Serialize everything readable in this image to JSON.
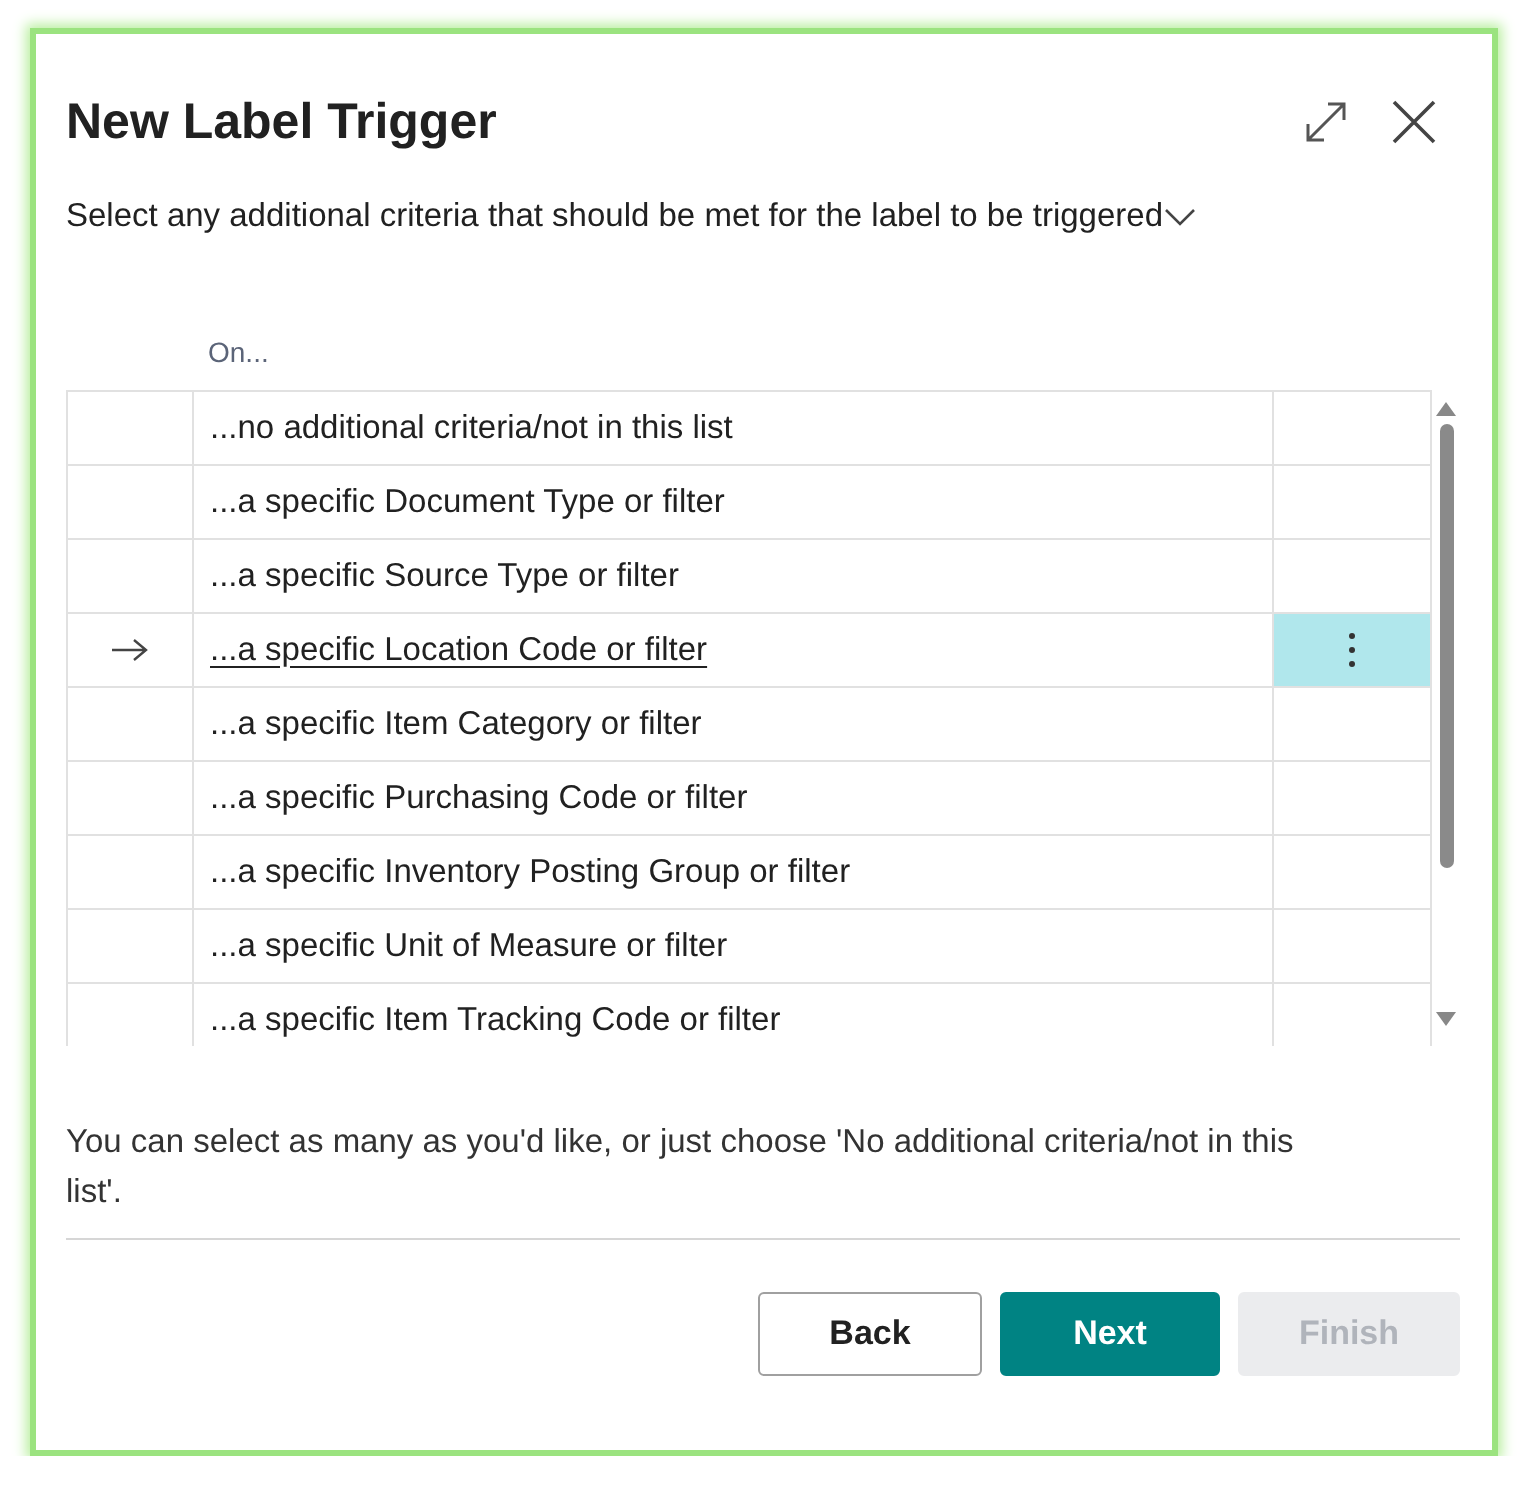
{
  "dialog": {
    "title": "New Label Trigger",
    "instruction": "Select any additional criteria that should be met for the label to be triggered",
    "instruction_expanded": false
  },
  "table": {
    "column_header": "On...",
    "rows": [
      {
        "label": "...no additional criteria/not in this list",
        "selected": false
      },
      {
        "label": "...a specific Document Type or filter",
        "selected": false
      },
      {
        "label": "...a specific Source Type or filter",
        "selected": false
      },
      {
        "label": "...a specific Location Code or filter",
        "selected": true
      },
      {
        "label": "...a specific Item Category or filter",
        "selected": false
      },
      {
        "label": "...a specific Purchasing Code or filter",
        "selected": false
      },
      {
        "label": "...a specific Inventory Posting Group or filter",
        "selected": false
      },
      {
        "label": "...a specific Unit of Measure or filter",
        "selected": false
      },
      {
        "label": "...a specific Item Tracking Code or filter",
        "selected": false
      }
    ]
  },
  "hint": "You can select as many as you'd like, or just choose 'No additional criteria/not in this list'.",
  "buttons": [
    {
      "label": "Back",
      "kind": "secondary",
      "disabled": false
    },
    {
      "label": "Next",
      "kind": "primary",
      "disabled": false
    },
    {
      "label": "Finish",
      "kind": "secondary",
      "disabled": true
    }
  ]
}
